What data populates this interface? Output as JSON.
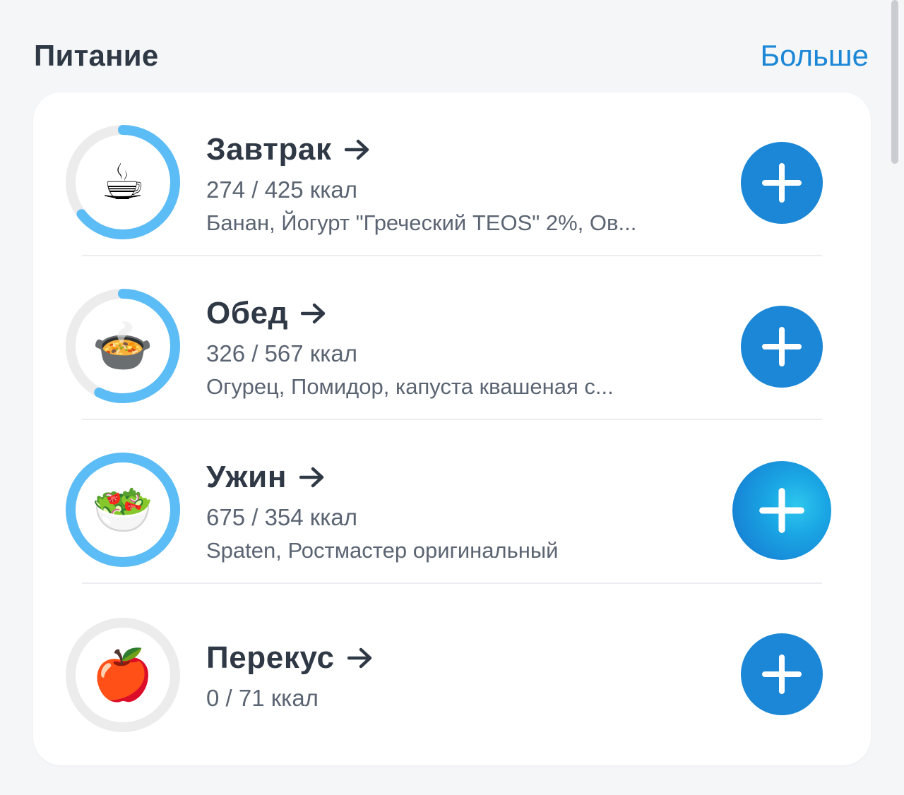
{
  "header": {
    "title": "Питание",
    "more_label": "Больше"
  },
  "colors": {
    "accent": "#1b87d6",
    "ring_progress": "#5cbcf6",
    "ring_track": "#ececec",
    "title_text": "#2f3845",
    "secondary_text": "#5b6472"
  },
  "meals": [
    {
      "name": "Завтрак",
      "kcal_text": "274 / 425 ккал",
      "items_text": "Банан, Йогурт \"Греческий TEOS\" 2%, Ов...",
      "emoji": "☕",
      "icon": "coffee-icon",
      "progress": 0.645
    },
    {
      "name": "Обед",
      "kcal_text": "326 / 567 ккал",
      "items_text": "Огурец, Помидор, капуста квашеная с...",
      "emoji": "🍲",
      "icon": "pot-of-food-icon",
      "progress": 0.575
    },
    {
      "name": "Ужин",
      "kcal_text": "675 / 354 ккал",
      "items_text": "Spaten, Ростмастер оригинальный",
      "emoji": "🥗",
      "icon": "salad-icon",
      "progress": 1.0
    },
    {
      "name": "Перекус",
      "kcal_text": "0 / 71 ккал",
      "items_text": "",
      "emoji": "🍎",
      "icon": "apple-icon",
      "progress": 0.0
    }
  ]
}
